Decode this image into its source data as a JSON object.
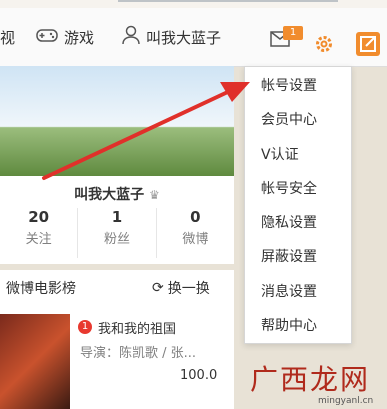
{
  "nav": {
    "video_label": "视",
    "game_label": "游戏",
    "user_label": "叫我大蓝子",
    "message_badge": "1"
  },
  "profile": {
    "name": "叫我大蓝子",
    "stats": [
      {
        "num": "20",
        "label": "关注"
      },
      {
        "num": "1",
        "label": "粉丝"
      },
      {
        "num": "0",
        "label": "微博"
      }
    ]
  },
  "movies": {
    "title": "微博电影榜",
    "refresh_label": "换一换",
    "item": {
      "rank": "1",
      "name": "我和我的祖国",
      "director": "导演：陈凯歌 / 张...",
      "score": "100.0"
    }
  },
  "settings_menu": [
    "帐号设置",
    "会员中心",
    "V认证",
    "帐号安全",
    "隐私设置",
    "屏蔽设置",
    "消息设置",
    "帮助中心"
  ],
  "watermark": {
    "main": "广西龙网",
    "sub": "mingyanl.cn"
  },
  "colors": {
    "accent": "#f18c2d",
    "arrow": "#e0302a"
  }
}
